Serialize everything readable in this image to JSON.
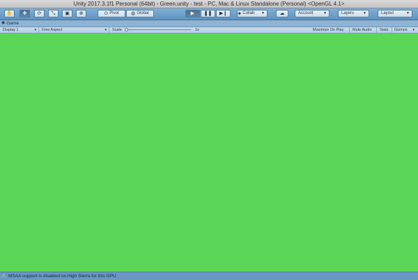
{
  "window": {
    "title": "Unity 2017.3.1f1 Personal (64bit) - Green.unity - test - PC, Mac & Linux Standalone (Personal) <OpenGL 4.1>"
  },
  "toolbar": {
    "tools": [
      {
        "icon": "hand-icon",
        "glyph": "✋"
      },
      {
        "icon": "move-icon",
        "glyph": "✥"
      },
      {
        "icon": "rotate-icon",
        "glyph": "⟳"
      },
      {
        "icon": "scale-icon",
        "glyph": "⤡"
      },
      {
        "icon": "rect-icon",
        "glyph": "▣"
      },
      {
        "icon": "transform-icon",
        "glyph": "⊕"
      }
    ],
    "pivot_label": "Pivot",
    "global_label": "Global",
    "play_glyph": "▶",
    "pause_glyph": "❚❚",
    "step_glyph": "▶❙",
    "collab_label": "Collab",
    "cloud_glyph": "☁",
    "account_label": "Account",
    "layers_label": "Layers",
    "layout_label": "Layout"
  },
  "tab": {
    "label": "Game"
  },
  "game_toolbar": {
    "display": "Display 1",
    "aspect": "Free Aspect",
    "scale_label": "Scale",
    "scale_value": "1x",
    "maximize_on_play": "Maximize On Play",
    "mute_audio": "Mute Audio",
    "stats": "Stats",
    "gizmos": "Gizmos"
  },
  "game_view": {
    "background_color": "#5bd656"
  },
  "status": {
    "message": "MSAA support is disabled on High Sierra for this GPU"
  },
  "colors": {
    "toolbar_accent": "#6fa3cc",
    "status_bar": "#6a98c0"
  }
}
